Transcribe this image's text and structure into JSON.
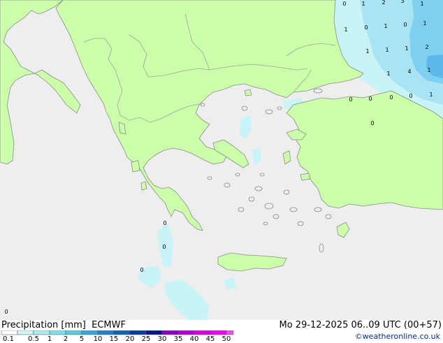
{
  "map": {
    "colors": {
      "sea": "#eeeeee",
      "land": "#ccffaa",
      "coast": "#8a8a8a",
      "border": "#a0a0a0",
      "precip_light": "#c8f4f8",
      "precip_mid": "#a8e4f4",
      "precip_high": "#7fd0f0",
      "precip_max": "#5bb8e8"
    },
    "station_values": [
      "0",
      "1",
      "2",
      "3",
      "1",
      "1",
      "0",
      "1",
      "0",
      "1",
      "1",
      "1",
      "1",
      "2",
      "1",
      "4",
      "1",
      "0",
      "0",
      "0",
      "0",
      "1",
      "0",
      "0",
      "0",
      "0",
      "0"
    ]
  },
  "footer": {
    "title": "Precipitation [mm]  ECMWF",
    "datetime": "Mo 29-12-2025 06..09 UTC (00+57)",
    "credit": "©weatheronline.co.uk"
  },
  "legend": {
    "ticks": [
      "0.1",
      "0.5",
      "1",
      "2",
      "5",
      "10",
      "15",
      "20",
      "25",
      "30",
      "35",
      "40",
      "45",
      "50"
    ],
    "colors": [
      "#ffffff",
      "#d2f5f8",
      "#a8ecf0",
      "#80dcea",
      "#5ac8e0",
      "#3aa6d6",
      "#2080c8",
      "#1460b4",
      "#0a3ca0",
      "#0a148c",
      "#8c00c8",
      "#b400dc",
      "#dc00e6",
      "#f000f0",
      "#f050f0"
    ]
  }
}
